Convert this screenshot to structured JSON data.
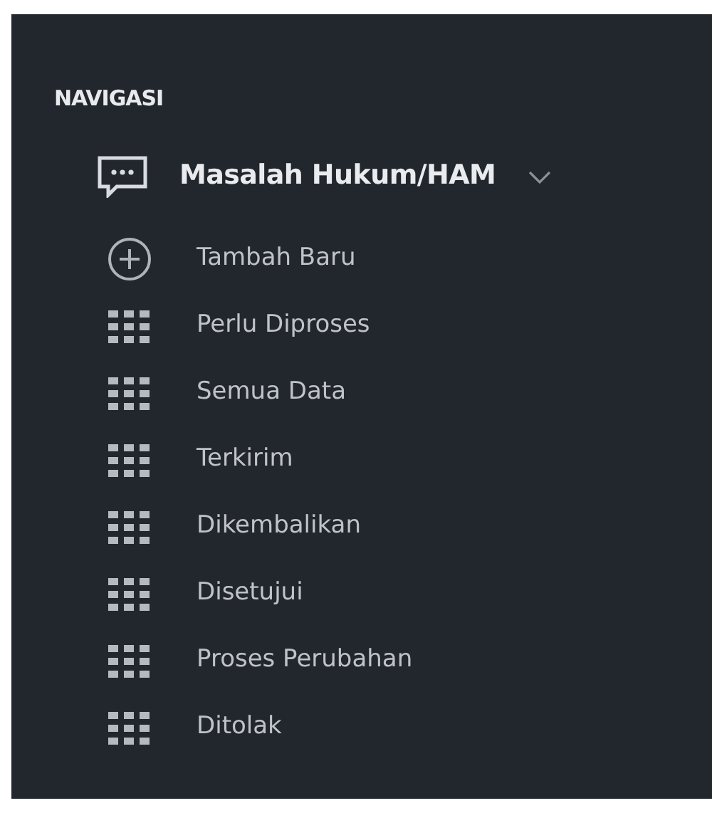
{
  "section_title": "NAVIGASI",
  "menu": {
    "label": "Masalah Hukum/HAM",
    "expanded": true,
    "items": [
      {
        "label": "Tambah Baru",
        "kind": "add"
      },
      {
        "label": "Perlu Diproses",
        "kind": "grid"
      },
      {
        "label": "Semua Data",
        "kind": "grid"
      },
      {
        "label": "Terkirim",
        "kind": "grid"
      },
      {
        "label": "Dikembalikan",
        "kind": "grid"
      },
      {
        "label": "Disetujui",
        "kind": "grid"
      },
      {
        "label": "Proses Perubahan",
        "kind": "grid"
      },
      {
        "label": "Ditolak",
        "kind": "grid"
      }
    ]
  }
}
